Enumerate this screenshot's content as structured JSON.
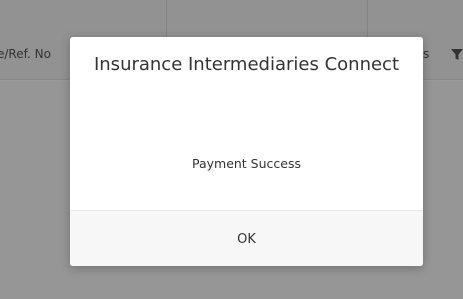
{
  "background_table": {
    "header_left_text": "e/Ref. No",
    "header_right_text": "s",
    "filter_icon": "filter-icon"
  },
  "dialog": {
    "title": "Insurance Intermediaries Connect",
    "message": "Payment Success",
    "ok_label": "OK"
  },
  "colors": {
    "overlay": "rgba(0,0,0,0.40)",
    "dialog_bg": "#ffffff",
    "footer_bg": "#f7f7f7",
    "text": "#333333"
  }
}
